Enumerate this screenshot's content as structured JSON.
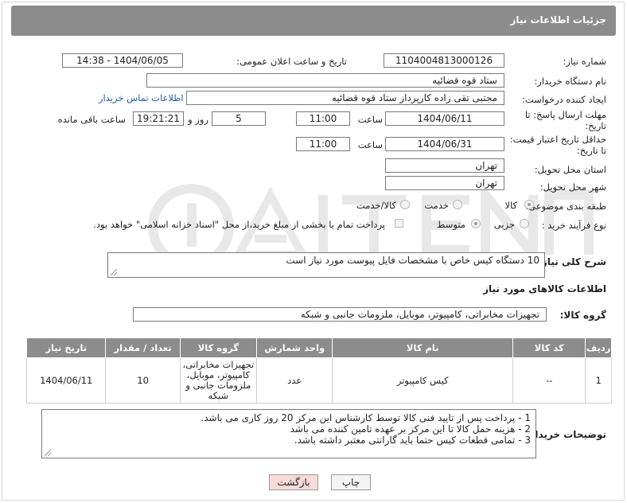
{
  "header": {
    "title": "جزئیات اطلاعات نیاز"
  },
  "form": {
    "need_number_label": "شماره نیاز:",
    "need_number": "1104004813000126",
    "announce_label": "تاریخ و ساعت اعلان عمومی:",
    "announce_value": "1404/06/05 - 14:38",
    "buyer_org_label": "نام دستگاه خریدار:",
    "buyer_org": "ستاد قوه قضائیه",
    "creator_label": "ایجاد کننده درخواست:",
    "creator": "مجتبی تقی زاده کارپرداز ستاد قوه قضائیه",
    "contact_link": "اطلاعات تماس خریدار",
    "deadline_label_1": "مهلت ارسال پاسخ: تا",
    "deadline_label_2": "تاریخ:",
    "deadline_date": "1404/06/11",
    "hour_label": "ساعت",
    "deadline_time": "11:00",
    "days_value": "5",
    "days_label": "روز و",
    "remaining_time": "19:21:21",
    "remaining_label": "ساعت باقی مانده",
    "validity_label_1": "حداقل تاریخ اعتبار قیمت:",
    "validity_label_2": "تا تاریخ:",
    "validity_date": "1404/06/31",
    "validity_hour_label": "ساعت",
    "validity_time": "11:00",
    "province_label": "استان محل تحویل:",
    "province": "تهران",
    "city_label": "شهر محل تحویل:",
    "city": "تهران",
    "category_label": "طبقه بندی موضوعی:",
    "category_options": [
      "کالا",
      "خدمت",
      "کالا/خدمت"
    ],
    "process_label": "نوع فرآیند خرید :",
    "process_options": [
      "جزیی",
      "متوسط"
    ],
    "payment_note": "پرداخت تمام یا بخشی از مبلغ خرید،از محل \"اسناد خزانه اسلامی\" خواهد بود.",
    "description_label": "شرح کلی نیاز:",
    "description": "10 دستگاه کیس خاص با مشخصات فایل پیوست مورد نیاز است"
  },
  "goods": {
    "section_title": "اطلاعات کالاهای مورد نیاز",
    "group_label": "گروه کالا:",
    "group_value": "تجهیزات مخابراتی، کامپیوتر، موبایل، ملزومات جانبی و شبکه",
    "columns": [
      "ردیف",
      "کد کالا",
      "نام کالا",
      "واحد شمارش",
      "گروه کالا",
      "تعداد / مقدار",
      "تاریخ نیاز"
    ],
    "rows": [
      [
        "1",
        "--",
        "کیس کامپیوتر",
        "عدد",
        "تجهیزات مخابراتی، کامپیوتر، موبایل، ملزومات جانبی و شبکه",
        "10",
        "1404/06/11"
      ]
    ]
  },
  "notes": {
    "label": "توضیحات خریدار:",
    "lines": [
      "1 - پرداخت پس از تایید فنی کالا توسط کارشناس این مرکز 20 روز کاری می باشد.",
      "2 - هزینه حمل کالا تا این مرکز بر عهده تامین کننده می باشد",
      "3 - تمامی قطعات کیس حتما باید گارانتی معتبر داشته باشد."
    ]
  },
  "buttons": {
    "print": "چاپ",
    "back": "بازگشت"
  },
  "colors": {
    "header_bg": "#8c8c8c",
    "link": "#1d5ea8",
    "back_button_bg": "#f8dada"
  }
}
